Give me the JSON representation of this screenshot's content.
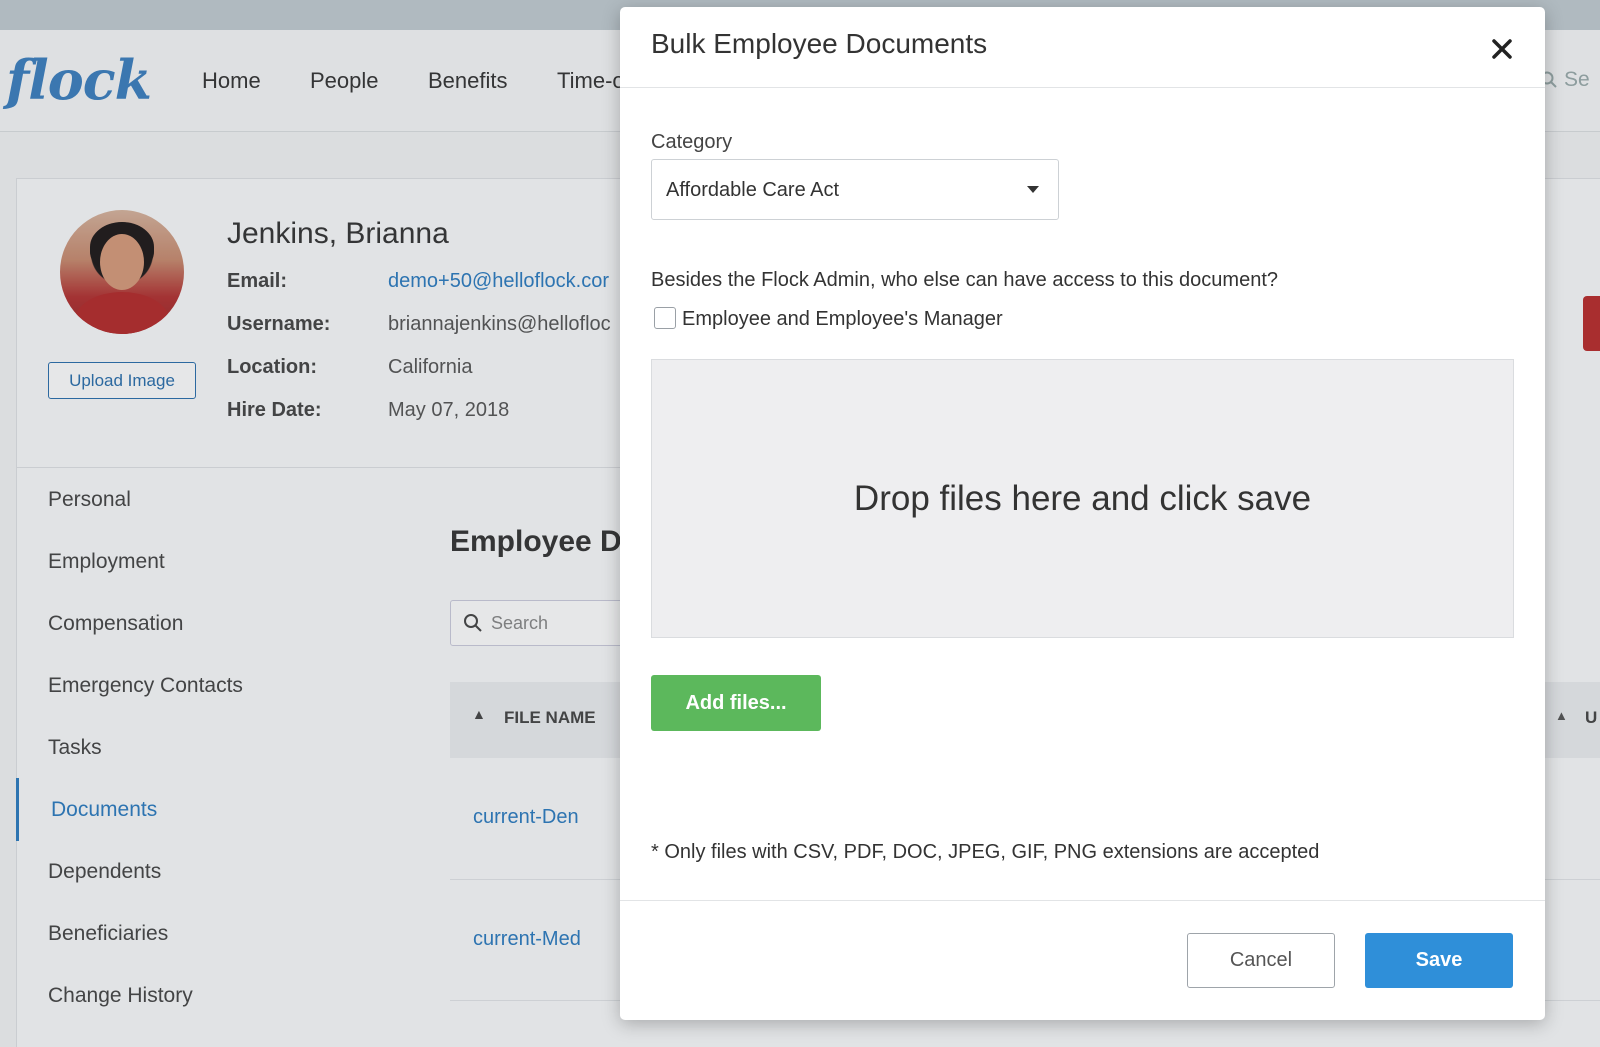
{
  "app": {
    "logo": "flock",
    "nav": [
      "Home",
      "People",
      "Benefits",
      "Time-o"
    ],
    "search_placeholder": "Se"
  },
  "profile": {
    "name": "Jenkins, Brianna",
    "upload_label": "Upload Image",
    "fields": [
      {
        "label": "Email:",
        "value": "demo+50@helloflock.cor"
      },
      {
        "label": "Username:",
        "value": "briannajenkins@hellofloc"
      },
      {
        "label": "Location:",
        "value": "California"
      },
      {
        "label": "Hire Date:",
        "value": "May 07, 2018"
      }
    ]
  },
  "sidebar": {
    "items": [
      "Personal",
      "Employment",
      "Compensation",
      "Emergency Contacts",
      "Tasks",
      "Documents",
      "Dependents",
      "Beneficiaries",
      "Change History"
    ],
    "active": "Documents"
  },
  "documents": {
    "title": "Employee Do",
    "search_placeholder": "Search",
    "col_file": "FILE NAME",
    "col_right": "U",
    "rows": [
      "current-Den",
      "current-Med"
    ]
  },
  "modal": {
    "title": "Bulk Employee Documents",
    "category_label": "Category",
    "category_value": "Affordable Care Act",
    "access_question": "Besides the Flock Admin, who else can have access to this document?",
    "access_option": "Employee and Employee's Manager",
    "access_checked": false,
    "dropzone_text": "Drop files here and click save",
    "add_files_label": "Add files...",
    "note": "* Only files with CSV, PDF, DOC, JPEG, GIF, PNG extensions are accepted",
    "cancel_label": "Cancel",
    "save_label": "Save"
  },
  "colors": {
    "primary": "#2f8fd9",
    "success": "#5cb85c",
    "link": "#2b7bc0"
  }
}
